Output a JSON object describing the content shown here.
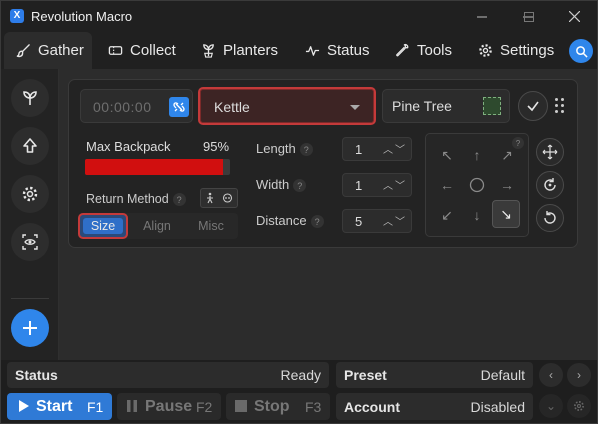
{
  "window": {
    "title": "Revolution Macro",
    "app_icon": "X"
  },
  "tabs": [
    {
      "label": "Gather",
      "icon": "brush-icon"
    },
    {
      "label": "Collect",
      "icon": "ticket-icon"
    },
    {
      "label": "Planters",
      "icon": "planter-icon"
    },
    {
      "label": "Status",
      "icon": "pulse-icon"
    },
    {
      "label": "Tools",
      "icon": "wrench-icon"
    },
    {
      "label": "Settings",
      "icon": "gear-icon"
    }
  ],
  "gather": {
    "timer": "00:00:00",
    "field_select": "Kettle",
    "pattern": "Pine Tree",
    "backpack": {
      "label": "Max Backpack",
      "percent_text": "95%",
      "percent": 0.95
    },
    "return_method": {
      "label": "Return Method",
      "help": "?"
    },
    "modes": [
      "Size",
      "Align",
      "Misc"
    ],
    "length": {
      "label": "Length",
      "value": "1",
      "help": "?"
    },
    "width": {
      "label": "Width",
      "value": "1",
      "help": "?"
    },
    "distance": {
      "label": "Distance",
      "value": "5",
      "help": "?"
    },
    "direction_help": "?"
  },
  "bottom": {
    "status_label": "Status",
    "status_value": "Ready",
    "preset_label": "Preset",
    "preset_value": "Default",
    "account_label": "Account",
    "account_value": "Disabled",
    "start_label": "Start",
    "start_key": "F1",
    "pause_label": "Pause",
    "pause_key": "F2",
    "stop_label": "Stop",
    "stop_key": "F3"
  },
  "colors": {
    "accent": "#2f86eb",
    "highlight": "#c43a3a",
    "backpack": "#d10f0f"
  }
}
